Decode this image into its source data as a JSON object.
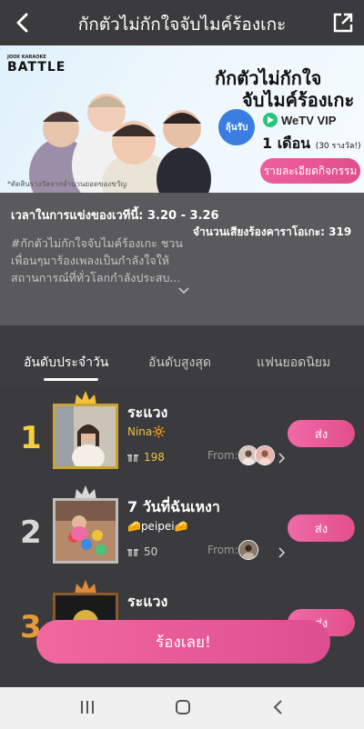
{
  "header": {
    "title": "กักตัวไม่กักใจจับไมค์ร้องเกะ",
    "back_icon": "back-arrow-icon",
    "share_icon": "share-icon"
  },
  "banner": {
    "brand_small": "JOOX KARAOKE",
    "brand_big": "BATTLE",
    "headline_line1": "กักตัวไม่กักใจ",
    "headline_line2": "จับไมค์ร้องเกะ",
    "prize_badge": "ลุ้นรับ",
    "wetv_logo": "WeTV VIP",
    "prize_main": "1 เดือน",
    "prize_sub": "(30 รางวัล!)",
    "note": "*ตัดสินรางวัลจากจำนวนยอดของขวัญ",
    "details_button": "รายละเอียดกิจกรรม"
  },
  "info": {
    "period": "เวลาในการแข่งของเวทีนี้: 3.20 - 3.26",
    "count": "จำนวนเสียงร้องคาราโอเกะ: 319",
    "description": "#กักตัวไม่กักใจจับไมค์ร้องเกะ ชวนเพื่อนๆมาร้องเพลงเป็นกำลังใจให้สถานการณ์ที่ทั่วโลกกำลังประสบ..."
  },
  "tabs": [
    {
      "label": "อันดับประจำวัน",
      "active": true
    },
    {
      "label": "อันดับสูงสุด",
      "active": false
    },
    {
      "label": "แฟนยอดนิยม",
      "active": false
    }
  ],
  "entries": [
    {
      "rank": "1",
      "song": "ระแวง",
      "singer": "Nina🔆",
      "gifts": "198",
      "from_label": "From:",
      "send_label": "ส่ง",
      "rank_color": "#f5d142",
      "crown_color": "#f0c23a"
    },
    {
      "rank": "2",
      "song": "7 วันที่ฉันเหงา",
      "singer": "🧀peipei🧀",
      "gifts": "50",
      "from_label": "From:",
      "send_label": "ส่ง",
      "rank_color": "#d8d8d8",
      "crown_color": "#d8d8d8"
    },
    {
      "rank": "3",
      "song": "ระแวง",
      "singer": "",
      "gifts": "",
      "from_label": "",
      "send_label": "ส่ง",
      "rank_color": "#e59a3a",
      "crown_color": "#e08a3a"
    }
  ],
  "sing_button": "ร้องเลย!",
  "navbar": {
    "icons": [
      "recent-apps-icon",
      "home-icon",
      "back-icon"
    ]
  },
  "colors": {
    "accent": "#e9579a",
    "gold": "#e8c24a"
  }
}
